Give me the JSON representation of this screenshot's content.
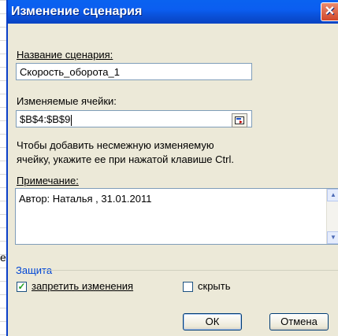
{
  "sheet": {
    "glyph": "e"
  },
  "dialog": {
    "title": "Изменение сценария",
    "close_symbol": "✕"
  },
  "scenario_name": {
    "label": "Название сценария:",
    "value": "Скорость_оборота_1"
  },
  "changing_cells": {
    "label": "Изменяемые ячейки:",
    "value": "$B$4:$B$9",
    "hint_line1": "Чтобы добавить несмежную изменяемую",
    "hint_line2": "ячейку, укажите ее при нажатой клавише Ctrl."
  },
  "comment": {
    "label": "Примечание:",
    "value": "Автор: Наталья , 31.01.2011",
    "scroll_up_symbol": "▲",
    "scroll_down_symbol": "▼"
  },
  "protection": {
    "group_label": "Защита",
    "prevent_changes": {
      "label": "запретить изменения",
      "checked": true,
      "check_symbol": "✓"
    },
    "hide": {
      "label": "скрыть",
      "checked": false
    }
  },
  "buttons": {
    "ok": "ОК",
    "cancel": "Отмена"
  }
}
